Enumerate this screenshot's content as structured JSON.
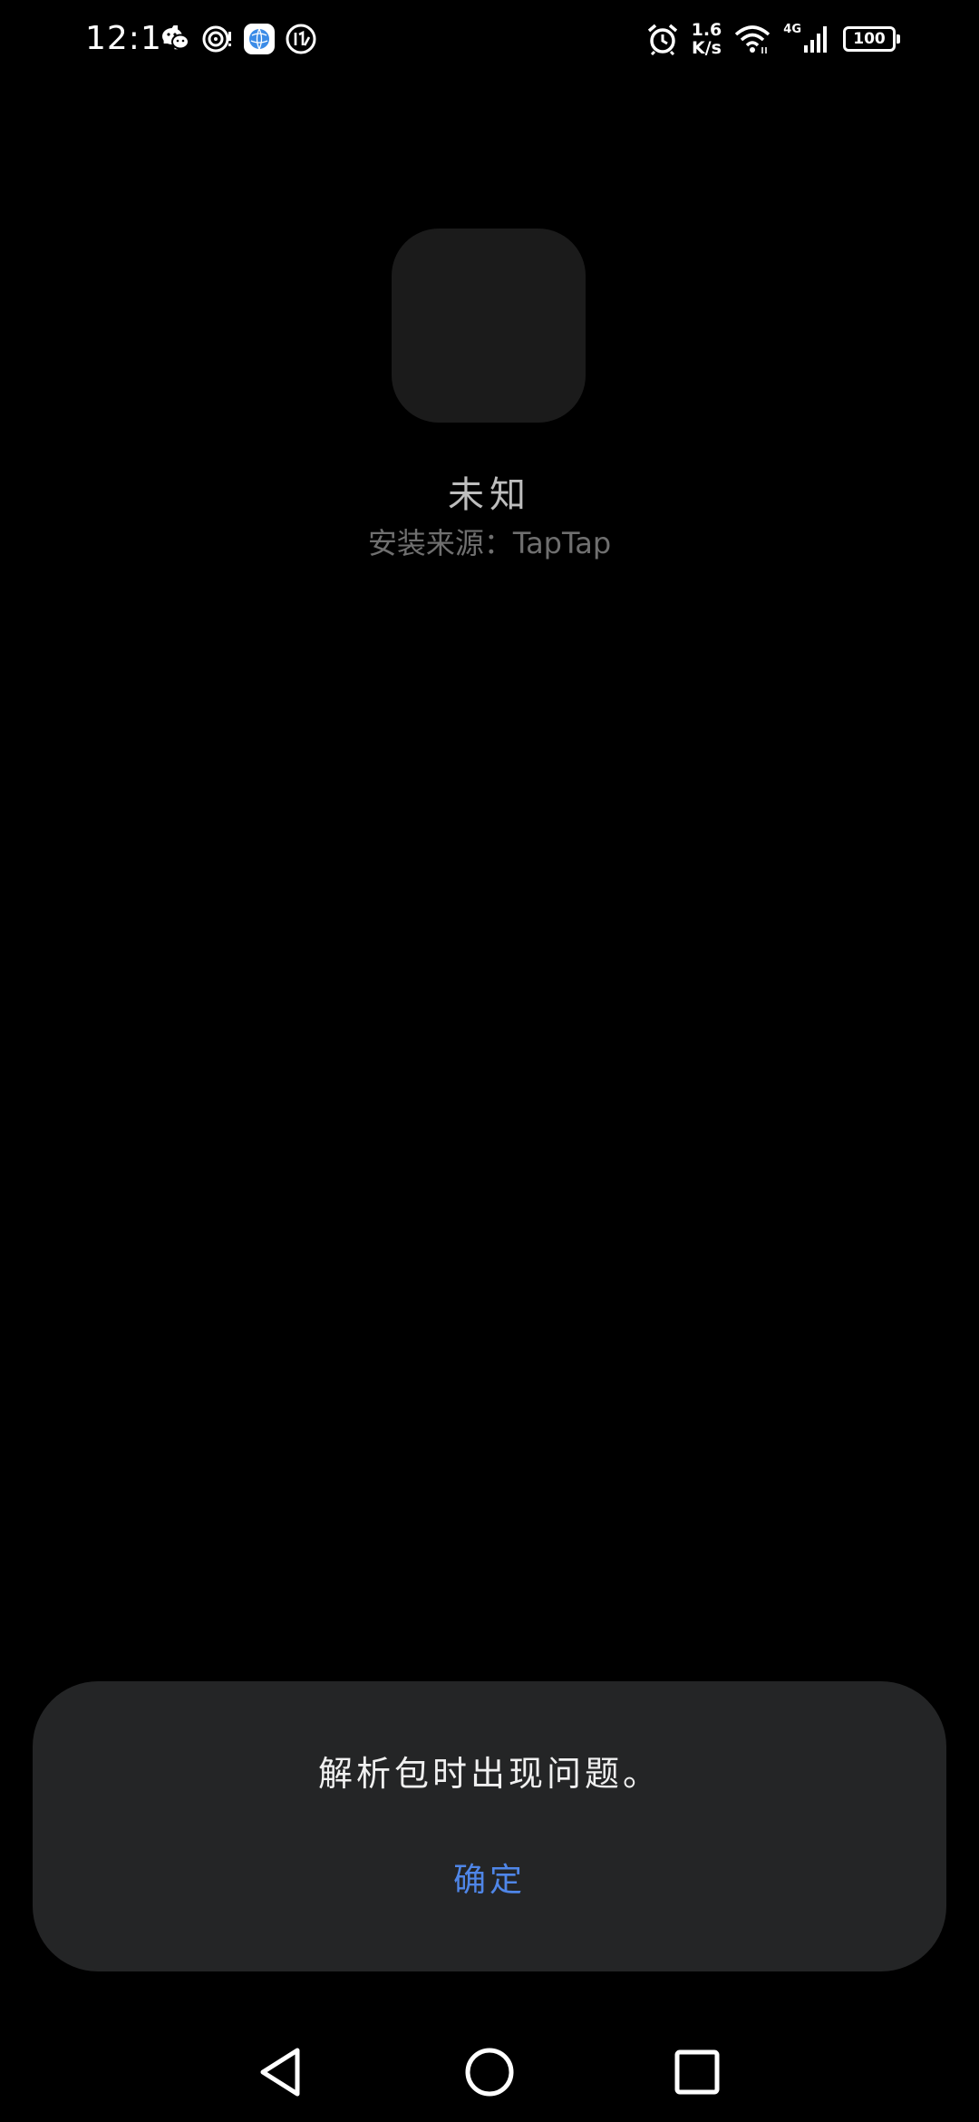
{
  "status_bar": {
    "time": "12:14",
    "net_speed_value": "1.6",
    "net_speed_unit": "K/s",
    "network_type": "4G",
    "battery_level": "100",
    "left_icons": [
      "wechat-icon",
      "target-icon",
      "browser-app-icon",
      "clock-app-icon"
    ],
    "right_icons": [
      "alarm-icon",
      "wifi-icon",
      "signal-icon",
      "battery-icon"
    ]
  },
  "app_info": {
    "name": "未知",
    "install_source": "安装来源：TapTap"
  },
  "dialog": {
    "message": "解析包时出现问题。",
    "ok_label": "确定",
    "ok_color": "#4f86e8"
  },
  "nav_bar": {
    "icons": [
      "back-triangle-icon",
      "home-circle-icon",
      "recent-square-icon"
    ]
  }
}
